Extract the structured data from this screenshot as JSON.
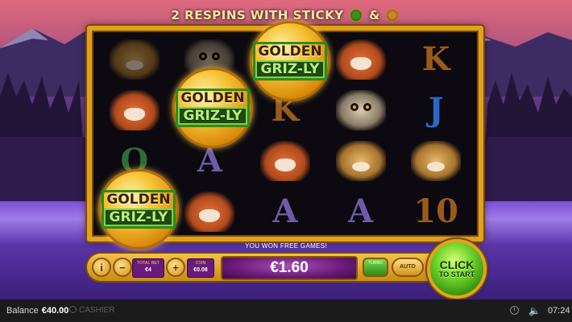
{
  "banner": {
    "text": "2 RESPINS WITH STICKY",
    "amp": "&",
    "icons": [
      "paw-icon",
      "bear-icon"
    ]
  },
  "reels": {
    "rows": [
      [
        {
          "type": "animal",
          "name": "lynx",
          "dim": true
        },
        {
          "type": "animal",
          "name": "owl",
          "dim": true
        },
        {
          "type": "blank"
        },
        {
          "type": "animal",
          "name": "fox"
        },
        {
          "type": "card",
          "label": "K",
          "tone": "gold"
        }
      ],
      [
        {
          "type": "animal",
          "name": "fox"
        },
        {
          "type": "blank"
        },
        {
          "type": "card",
          "label": "K",
          "tone": "gold"
        },
        {
          "type": "animal",
          "name": "owl"
        },
        {
          "type": "card",
          "label": "J",
          "tone": "blue"
        }
      ],
      [
        {
          "type": "card",
          "label": "Q",
          "tone": "green"
        },
        {
          "type": "card",
          "label": "A",
          "tone": "purple"
        },
        {
          "type": "animal",
          "name": "fox"
        },
        {
          "type": "animal",
          "name": "lynx"
        },
        {
          "type": "animal",
          "name": "lynx"
        }
      ],
      [
        {
          "type": "blank"
        },
        {
          "type": "animal",
          "name": "fox"
        },
        {
          "type": "card",
          "label": "A",
          "tone": "purple"
        },
        {
          "type": "card",
          "label": "A",
          "tone": "purple"
        },
        {
          "type": "card",
          "label": "10",
          "tone": "gold"
        }
      ]
    ],
    "coins": [
      {
        "line1": "GOLDEN",
        "line2": "GRIZ-LY"
      },
      {
        "line1": "GOLDEN",
        "line2": "GRIZ-LY"
      },
      {
        "line1": "GOLDEN",
        "line2": "GRIZ-LY"
      }
    ]
  },
  "message": "YOU WON FREE GAMES!",
  "controls": {
    "info_label": "i",
    "minus_label": "−",
    "plus_label": "+",
    "total_bet_caption": "TOTAL BET",
    "total_bet_value": "€4",
    "coin_caption": "COIN",
    "coin_value": "€0.08",
    "win_amount": "€1.60",
    "turbo_label": "TURBO",
    "auto_label": "AUTO",
    "start_line1": "CLICK",
    "start_line2": "TO START"
  },
  "statusbar": {
    "balance_label": "Balance",
    "balance_value": "€40.00",
    "cashier_label": "CASHIER",
    "time": "07:24"
  },
  "colors": {
    "frame": "#e0a21d",
    "start_button": "#6fd22a",
    "win_display": "#6a1a78"
  }
}
